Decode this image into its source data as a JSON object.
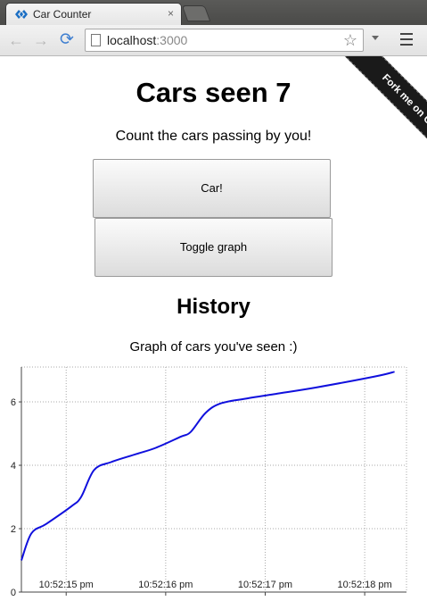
{
  "browser": {
    "tab_title": "Car Counter",
    "tab_close": "×",
    "url_host": "localhost",
    "url_port": ":3000",
    "back_icon": "←",
    "forward_icon": "→",
    "reload_icon": "⟳",
    "star_icon": "☆"
  },
  "ribbon": {
    "label": "Fork me on GitHub"
  },
  "header": {
    "title": "Cars seen 7",
    "subtitle": "Count the cars passing by you!"
  },
  "buttons": {
    "car_label": "Car!",
    "toggle_label": "Toggle graph"
  },
  "history": {
    "title": "History",
    "subtitle": "Graph of cars you've seen :)"
  },
  "colors": {
    "line": "#1010dd",
    "grid": "#aaaaaa",
    "axis": "#444444"
  },
  "chart_data": {
    "type": "line",
    "xlabel": "",
    "ylabel": "",
    "ylim": [
      0,
      7.1
    ],
    "y_ticks": [
      0,
      2,
      4,
      6
    ],
    "x_ticks": [
      "10:52:15 pm",
      "10:52:16 pm",
      "10:52:17 pm",
      "10:52:18 pm"
    ],
    "grid": true,
    "series": [
      {
        "x": [
          14.55,
          14.65,
          14.8,
          15.05,
          15.15,
          15.28,
          15.45,
          15.7,
          15.9,
          16.15,
          16.25,
          16.4,
          16.55,
          16.8,
          17.1,
          17.5,
          18.1,
          18.3
        ],
        "values": [
          1.0,
          1.85,
          2.15,
          2.7,
          3.0,
          3.85,
          4.1,
          4.35,
          4.55,
          4.9,
          5.05,
          5.65,
          5.95,
          6.1,
          6.25,
          6.45,
          6.8,
          6.95
        ]
      }
    ]
  }
}
